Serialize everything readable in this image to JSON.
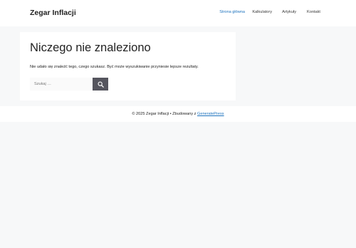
{
  "header": {
    "site_title": "Zegar Inflacji",
    "nav": [
      {
        "label": "Strona główna",
        "active": true
      },
      {
        "label": "Kalkulatory",
        "active": false
      },
      {
        "label": "Artykuły",
        "active": false
      },
      {
        "label": "Kontakt",
        "active": false
      }
    ]
  },
  "main": {
    "title": "Niczego nie znaleziono",
    "message": "Nie udało się znaleźć tego, czego szukasz. Być może wyszukiwanie przyniesie lepsze rezultaty.",
    "search": {
      "placeholder": "Szukaj …",
      "value": "",
      "button_icon": "search-icon"
    }
  },
  "footer": {
    "text_prefix": "© 2025 Zegar Inflacji • Zbudowany z",
    "link_label": "GeneratePress"
  },
  "colors": {
    "page_background": "#f7f8f9",
    "accent": "#1e73be",
    "search_button": "#55555e"
  }
}
